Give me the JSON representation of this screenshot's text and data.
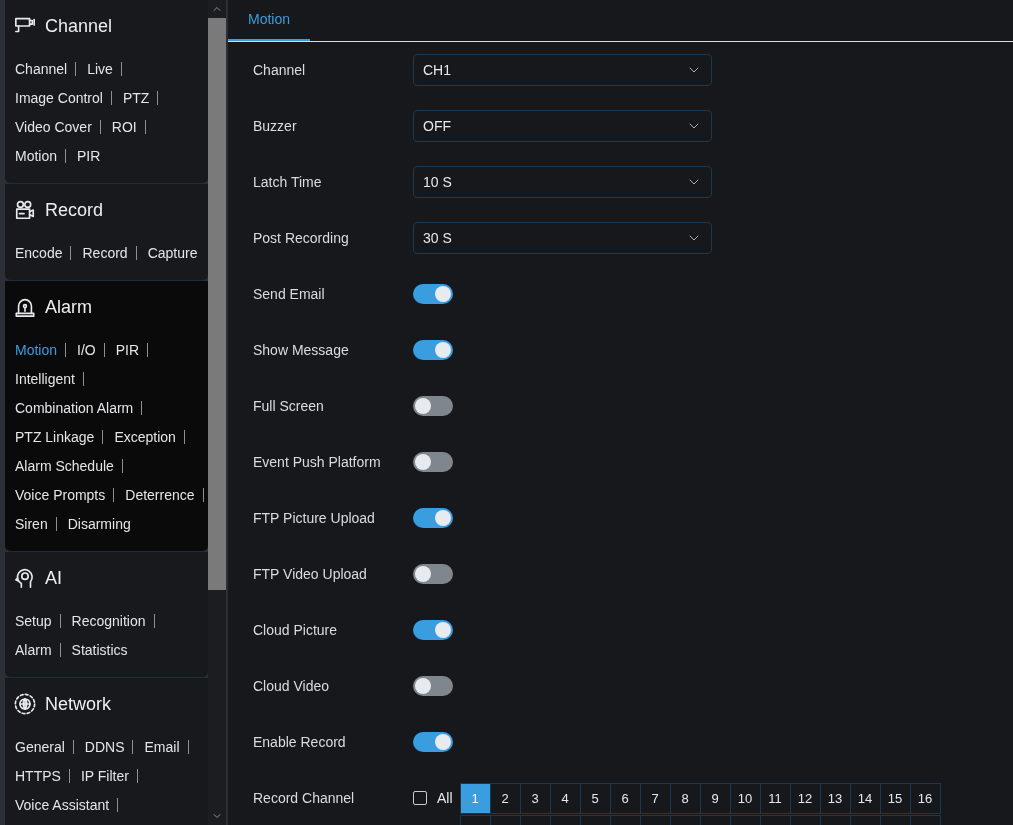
{
  "sidebar": {
    "sections": [
      {
        "kind": "channel",
        "title": "Channel",
        "selected": false,
        "cut_off": false,
        "items": [
          {
            "label": "Channel",
            "selected": false
          },
          {
            "label": "Live",
            "selected": false
          },
          {
            "label": "Image Control",
            "selected": false
          },
          {
            "label": "PTZ",
            "selected": false
          },
          {
            "label": "Video Cover",
            "selected": false
          },
          {
            "label": "ROI",
            "selected": false
          },
          {
            "label": "Motion",
            "selected": false
          },
          {
            "label": "PIR",
            "selected": false
          }
        ]
      },
      {
        "kind": "record",
        "title": "Record",
        "selected": false,
        "cut_off": false,
        "items": [
          {
            "label": "Encode",
            "selected": false
          },
          {
            "label": "Record",
            "selected": false
          },
          {
            "label": "Capture",
            "selected": false
          }
        ]
      },
      {
        "kind": "alarm",
        "title": "Alarm",
        "selected": true,
        "cut_off": false,
        "items": [
          {
            "label": "Motion",
            "selected": true
          },
          {
            "label": "I/O",
            "selected": false
          },
          {
            "label": "PIR",
            "selected": false
          },
          {
            "label": "Intelligent",
            "selected": false
          },
          {
            "label": "Combination Alarm",
            "selected": false
          },
          {
            "label": "PTZ Linkage",
            "selected": false
          },
          {
            "label": "Exception",
            "selected": false
          },
          {
            "label": "Alarm Schedule",
            "selected": false
          },
          {
            "label": "Voice Prompts",
            "selected": false
          },
          {
            "label": "Deterrence",
            "selected": false
          },
          {
            "label": "Siren",
            "selected": false
          },
          {
            "label": "Disarming",
            "selected": false
          }
        ]
      },
      {
        "kind": "ai",
        "title": "AI",
        "selected": false,
        "cut_off": false,
        "items": [
          {
            "label": "Setup",
            "selected": false
          },
          {
            "label": "Recognition",
            "selected": false
          },
          {
            "label": "Alarm",
            "selected": false
          },
          {
            "label": "Statistics",
            "selected": false
          }
        ]
      },
      {
        "kind": "network",
        "title": "Network",
        "selected": false,
        "cut_off": true,
        "items": [
          {
            "label": "General",
            "selected": false
          },
          {
            "label": "DDNS",
            "selected": false
          },
          {
            "label": "Email",
            "selected": false
          },
          {
            "label": "HTTPS",
            "selected": false
          },
          {
            "label": "IP Filter",
            "selected": false
          },
          {
            "label": "Voice Assistant",
            "selected": false
          }
        ]
      }
    ]
  },
  "tabs": [
    {
      "label": "Motion",
      "selected": true
    }
  ],
  "settings": [
    {
      "kind": "select",
      "label": "Channel",
      "value": "CH1"
    },
    {
      "kind": "select",
      "label": "Buzzer",
      "value": "OFF"
    },
    {
      "kind": "select",
      "label": "Latch Time",
      "value": "10 S"
    },
    {
      "kind": "select",
      "label": "Post Recording",
      "value": "30 S"
    },
    {
      "kind": "toggle",
      "label": "Send Email",
      "on": true
    },
    {
      "kind": "toggle",
      "label": "Show Message",
      "on": true
    },
    {
      "kind": "toggle",
      "label": "Full Screen",
      "on": false
    },
    {
      "kind": "toggle",
      "label": "Event Push Platform",
      "on": false
    },
    {
      "kind": "toggle",
      "label": "FTP Picture Upload",
      "on": true
    },
    {
      "kind": "toggle",
      "label": "FTP Video Upload",
      "on": false
    },
    {
      "kind": "toggle",
      "label": "Cloud Picture",
      "on": true
    },
    {
      "kind": "toggle",
      "label": "Cloud Video",
      "on": false
    },
    {
      "kind": "toggle",
      "label": "Enable Record",
      "on": true
    },
    {
      "kind": "channels",
      "label": "Record Channel",
      "all": {
        "label": "All",
        "checked": false
      },
      "channels": [
        {
          "label": "1",
          "selected": true
        },
        {
          "label": "2",
          "selected": false
        },
        {
          "label": "3",
          "selected": false
        },
        {
          "label": "4",
          "selected": false
        },
        {
          "label": "5",
          "selected": false
        },
        {
          "label": "6",
          "selected": false
        },
        {
          "label": "7",
          "selected": false
        },
        {
          "label": "8",
          "selected": false
        },
        {
          "label": "9",
          "selected": false
        },
        {
          "label": "10",
          "selected": false
        },
        {
          "label": "11",
          "selected": false
        },
        {
          "label": "12",
          "selected": false
        },
        {
          "label": "13",
          "selected": false
        },
        {
          "label": "14",
          "selected": false
        },
        {
          "label": "15",
          "selected": false
        },
        {
          "label": "16",
          "selected": false
        }
      ]
    }
  ]
}
